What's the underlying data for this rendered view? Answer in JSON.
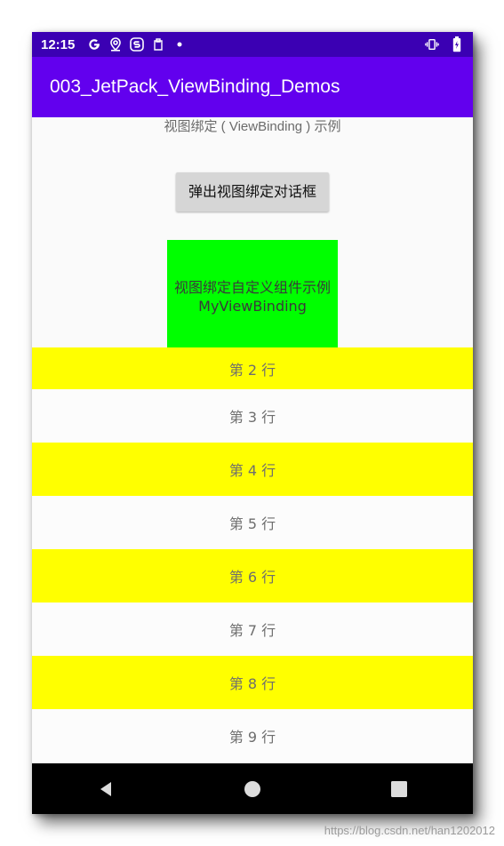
{
  "status_bar": {
    "time": "12:15",
    "left_icons": [
      "google-g-icon",
      "location-pin-icon",
      "s-app-icon",
      "clipboard-icon",
      "dot-icon"
    ],
    "right_icons": [
      "vibrate-icon",
      "battery-icon"
    ]
  },
  "app_bar": {
    "title": "003_JetPack_ViewBinding_Demos"
  },
  "main": {
    "subtitle": "视图绑定 ( ViewBinding ) 示例",
    "dialog_button_label": "弹出视图绑定对话框",
    "custom_component": {
      "line1": "视图绑定自定义组件示例",
      "line2": "MyViewBinding",
      "bg_color": "#00ff00"
    },
    "rows": [
      {
        "label": "第 2 行",
        "color": "#ffff00"
      },
      {
        "label": "第 3 行",
        "color": "#fcfcfc"
      },
      {
        "label": "第 4 行",
        "color": "#ffff00"
      },
      {
        "label": "第 5 行",
        "color": "#fcfcfc"
      },
      {
        "label": "第 6 行",
        "color": "#ffff00"
      },
      {
        "label": "第 7 行",
        "color": "#fcfcfc"
      },
      {
        "label": "第 8 行",
        "color": "#ffff00"
      },
      {
        "label": "第 9 行",
        "color": "#fcfcfc"
      }
    ]
  },
  "nav_bar": {
    "icons": [
      "back-icon",
      "home-icon",
      "recents-icon"
    ]
  },
  "watermark": "https://blog.csdn.net/han1202012",
  "colors": {
    "status_bar": "#3b00b3",
    "app_bar": "#6200ee",
    "row_yellow": "#ffff00"
  }
}
